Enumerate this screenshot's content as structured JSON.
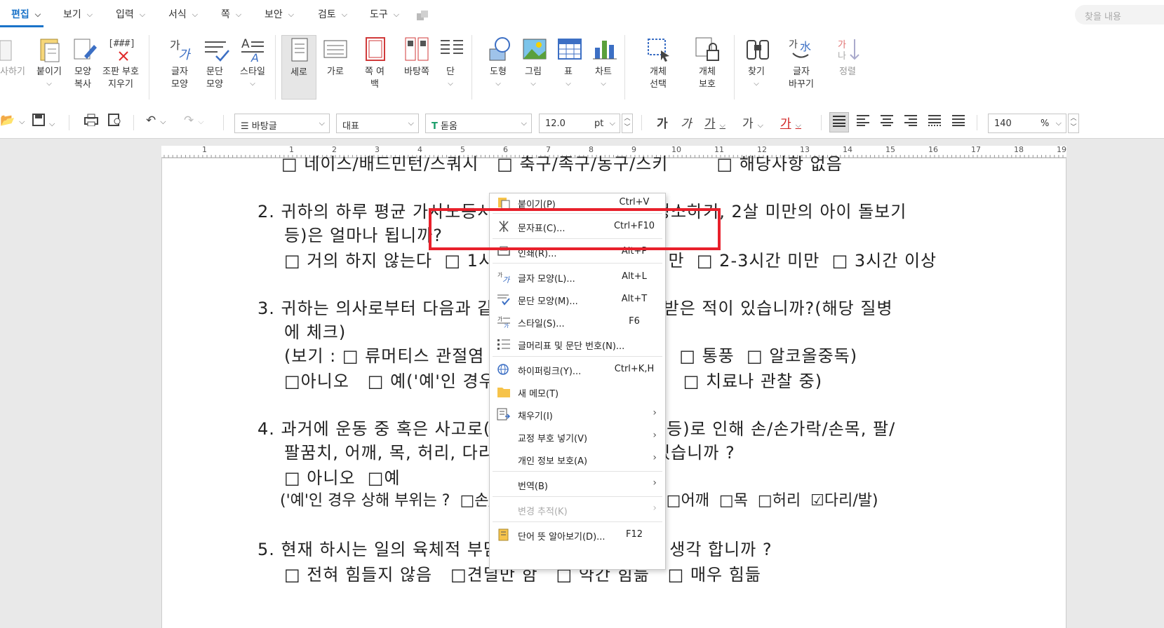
{
  "menubar": {
    "items": [
      "편집",
      "보기",
      "입력",
      "서식",
      "쪽",
      "보안",
      "검토",
      "도구"
    ],
    "search_placeholder": "찾을 내용"
  },
  "ribbon": {
    "buttons": [
      "오려두기",
      "붙이기",
      "모양 복사",
      "조판 부호 지우기",
      "글자 모양",
      "문단 모양",
      "스타일",
      "세로",
      "가로",
      "쪽 여백",
      "바탕쪽",
      "단",
      "도형",
      "그림",
      "표",
      "차트",
      "개체 선택",
      "개체 보호",
      "찾기",
      "글자 바꾸기",
      "정렬"
    ],
    "cut_partial": "사하기",
    "markup_icon": "[###]"
  },
  "toolbar": {
    "style": "바탕글",
    "lang": "대표",
    "font": "돋움",
    "size": "12.0",
    "unit": "pt",
    "zoom": "140",
    "zoom_unit": "%",
    "char_btns": [
      "가",
      "가",
      "가",
      "가",
      "가"
    ]
  },
  "ruler": {
    "ticks": [
      "1",
      "1",
      "2",
      "3",
      "4",
      "5",
      "6",
      "7",
      "8",
      "9",
      "10",
      "11",
      "12",
      "13",
      "14",
      "15",
      "16",
      "17",
      "18",
      "19"
    ]
  },
  "document": {
    "lines": [
      "□ 네이스/배드민턴/스쿼시   □ 축구/족구/농구/스키        □ 해당사항 없음",
      "2. 귀하의 하루 평균 가사노동시간(밥하기, 빨래하기, 청소하기, 2살 미만의 아이 돌보기",
      "등)은 얼마나 됩니까?",
      "□ 거의 하지 않는다  □ 1시간 미만  □ 1-2시간 미만  □ 2-3시간 미만  □ 3시간 이상",
      "3. 귀하는 의사로부터 다음과 같은 질병에 대해 진단을 받은 적이 있습니까?(해당 질병",
      "에 체크)",
      "(보기 : □ 류머티스 관절염  □ 당뇨병  □ 루프스병  □ 통풍  □ 알코올중독)",
      "□아니오   □ 예('예'인 경우 현재상태는?  □ 완치    □ 치료나 관찰 중)",
      "4. 과거에 운동 중 혹은 사고로(교통사고, 넘어짐, 추락 등)로 인해 손/손가락/손목, 팔/",
      "팔꿈치, 어깨, 목, 허리, 다리/발 부위를 다친 적인 있습니까 ?",
      "□ 아니오  □예",
      "('예'인 경우 상해 부위는 ?  □손/손가락/손목  □팔/팔꿈치  □어깨  □목  □허리  ☑다리/발)",
      "5. 현재 하시는 일의 육체적 부담 정도는 어느 정도라고 생각 합니까 ?",
      "□ 전혀 힘들지 않음   □견딜만 함   □ 약간 힘듦   □ 매우 힘듦"
    ]
  },
  "context_menu": {
    "items": [
      {
        "label": "붙이기(P)",
        "shortcut": "Ctrl+V"
      },
      {
        "label": "문자표(C)...",
        "shortcut": "Ctrl+F10"
      },
      {
        "label": "인쇄(R)...",
        "shortcut": "Alt+P"
      },
      {
        "label": "글자 모양(L)...",
        "shortcut": "Alt+L"
      },
      {
        "label": "문단 모양(M)...",
        "shortcut": "Alt+T"
      },
      {
        "label": "스타일(S)...",
        "shortcut": "F6"
      },
      {
        "label": "글머리표 및 문단 번호(N)...",
        "shortcut": ""
      },
      {
        "label": "하이퍼링크(Y)...",
        "shortcut": "Ctrl+K,H"
      },
      {
        "label": "새 메모(T)",
        "shortcut": ""
      },
      {
        "label": "채우기(I)",
        "shortcut": ""
      },
      {
        "label": "교정 부호 넣기(V)",
        "shortcut": ""
      },
      {
        "label": "개인 정보 보호(A)",
        "shortcut": ""
      },
      {
        "label": "번역(B)",
        "shortcut": ""
      },
      {
        "label": "변경 추적(K)",
        "shortcut": ""
      },
      {
        "label": "단어 뜻 알아보기(D)...",
        "shortcut": "F12"
      }
    ]
  },
  "colors": {
    "accent": "#1a73c9",
    "highlight": "#e8202b"
  }
}
